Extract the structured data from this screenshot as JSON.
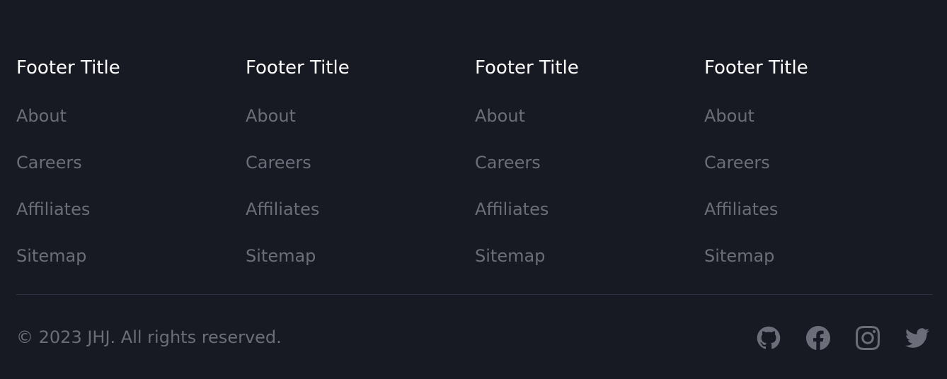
{
  "footer": {
    "columns": [
      {
        "title": "Footer Title",
        "links": [
          "About",
          "Careers",
          "Affiliates",
          "Sitemap"
        ]
      },
      {
        "title": "Footer Title",
        "links": [
          "About",
          "Careers",
          "Affiliates",
          "Sitemap"
        ]
      },
      {
        "title": "Footer Title",
        "links": [
          "About",
          "Careers",
          "Affiliates",
          "Sitemap"
        ]
      },
      {
        "title": "Footer Title",
        "links": [
          "About",
          "Careers",
          "Affiliates",
          "Sitemap"
        ]
      }
    ],
    "copyright": "© 2023 JHJ. All rights reserved.",
    "socials": [
      {
        "icon": "github-icon"
      },
      {
        "icon": "facebook-icon"
      },
      {
        "icon": "instagram-icon"
      },
      {
        "icon": "twitter-icon"
      }
    ]
  },
  "colors": {
    "background": "#171923",
    "title": "#ffffff",
    "muted": "#6b6e78",
    "divider": "#2d3040"
  }
}
